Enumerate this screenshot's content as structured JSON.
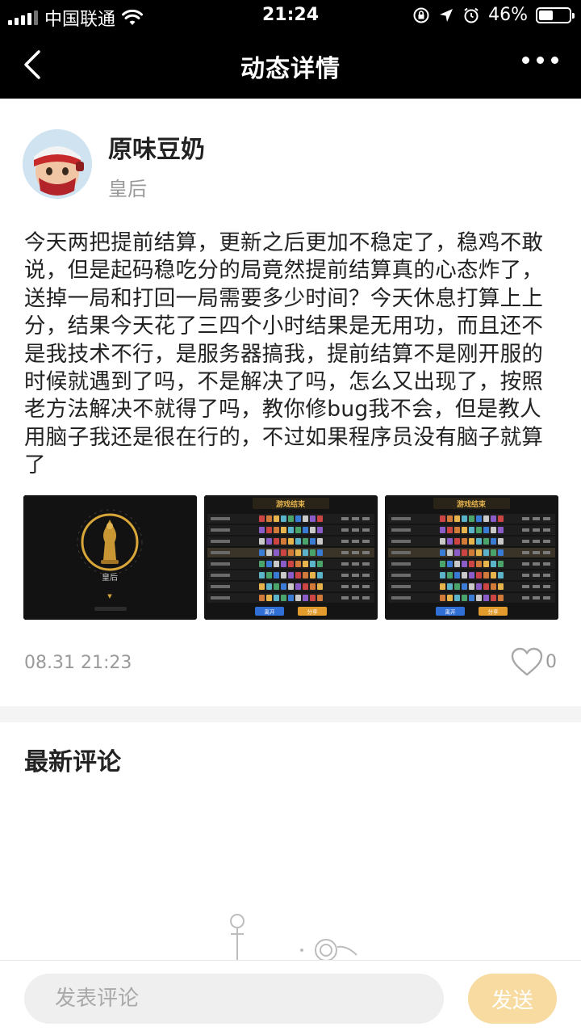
{
  "status_bar": {
    "carrier": "中国联通",
    "time": "21:24",
    "battery_percent": "46%",
    "battery_level": 0.46,
    "icons": [
      "signal-icon",
      "wifi-icon",
      "rotation-lock-icon",
      "location-icon",
      "alarm-icon",
      "battery-icon"
    ]
  },
  "nav": {
    "title": "动态详情",
    "back_icon": "back-arrow-icon",
    "more_icon": "more-dots-icon"
  },
  "post": {
    "username": "原味豆奶",
    "user_title": "皇后",
    "content": "今天两把提前结算，更新之后更加不稳定了，稳鸡不敢说，但是起码稳吃分的局竟然提前结算真的心态炸了，送掉一局和打回一局需要多少时间？今天休息打算上上分，结果今天花了三四个小时结果是无用功，而且还不是我技术不行，是服务器搞我，提前结算不是刚开服的时候就遇到了吗，不是解决了吗，怎么又出现了，按照老方法解决不就得了吗，教你修bug我不会，但是教人用脑子我还是很在行的，不过如果程序员没有脑子就算了",
    "images": [
      {
        "kind": "rank-badge",
        "rank_label": "皇后"
      },
      {
        "kind": "game-result",
        "header": "游戏结束",
        "buttons": [
          "离开",
          "分享"
        ]
      },
      {
        "kind": "game-result",
        "header": "游戏结束",
        "buttons": [
          "离开",
          "分享"
        ]
      }
    ],
    "timestamp": "08.31 21:23",
    "like_count": "0"
  },
  "comments": {
    "title": "最新评论"
  },
  "bottom": {
    "input_placeholder": "发表评论",
    "send_label": "发送"
  },
  "colors": {
    "bar_background": "#000000",
    "send_button": "#f7dba0",
    "muted_text": "#9a9a9a",
    "gold": "#d9a63a"
  }
}
